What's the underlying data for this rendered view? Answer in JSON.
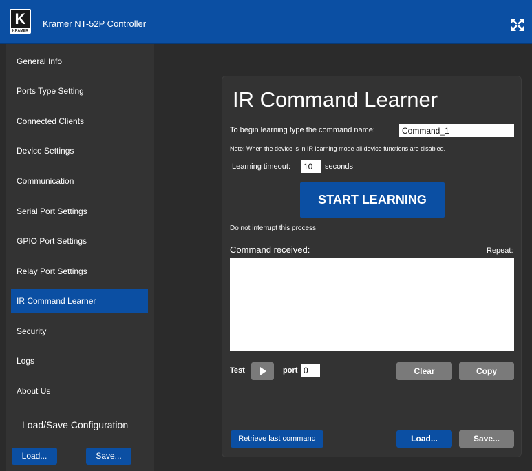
{
  "header": {
    "logo_text": "K",
    "logo_sub": "KRAMER",
    "title": "Kramer NT-52P Controller",
    "expand_icon": "expand-arrows-icon",
    "color": "#0b4fa3"
  },
  "sidebar": {
    "items": [
      {
        "label": "General Info"
      },
      {
        "label": "Ports Type Setting"
      },
      {
        "label": "Connected Clients"
      },
      {
        "label": "Device Settings"
      },
      {
        "label": "Communication"
      },
      {
        "label": "Serial Port Settings"
      },
      {
        "label": "GPIO Port Settings"
      },
      {
        "label": "Relay Port Settings"
      },
      {
        "label": "IR Command Learner",
        "active": true
      },
      {
        "label": "Security"
      },
      {
        "label": "Logs"
      },
      {
        "label": "About Us"
      }
    ],
    "load_save_title": "Load/Save Configuration",
    "load_label": "Load...",
    "save_label": "Save..."
  },
  "main": {
    "title": "IR Command Learner",
    "command_name_label": "To begin learning type the command name:",
    "command_name_value": "Command_1",
    "note": "Note: When the device is in IR learning mode all device functions are disabled.",
    "timeout_label": "Learning timeout:",
    "timeout_value": "10",
    "timeout_unit": "seconds",
    "start_button": "START LEARNING",
    "interrupt_note": "Do not interrupt this process",
    "command_received_label": "Command received:",
    "repeat_label": "Repeat:",
    "command_received_value": "",
    "test_label": "Test",
    "port_label": "port",
    "port_value": "0",
    "clear_button": "Clear",
    "copy_button": "Copy",
    "retrieve_button": "Retrieve last command",
    "load_button": "Load...",
    "save_button": "Save..."
  },
  "colors": {
    "accent": "#0b4fa3",
    "button_gray": "#7a7a7a",
    "background": "#2b2b2b",
    "panel": "#333333"
  }
}
